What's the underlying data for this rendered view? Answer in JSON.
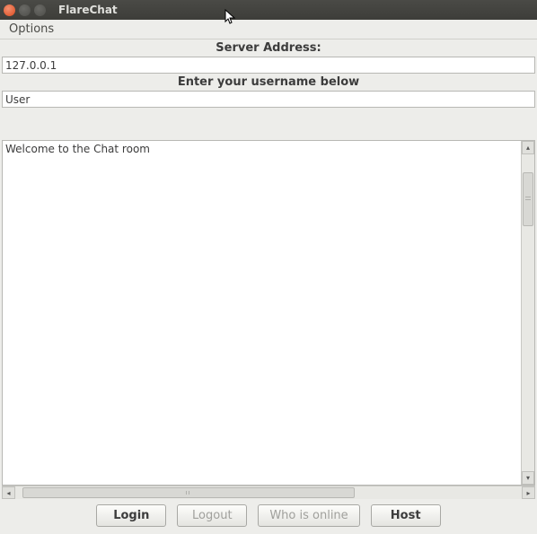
{
  "window": {
    "title": "FlareChat"
  },
  "menu": {
    "options": "Options"
  },
  "labels": {
    "server_address": "Server Address:",
    "username_prompt": "Enter your username below"
  },
  "inputs": {
    "server": "127.0.0.1",
    "username": "User"
  },
  "chat": {
    "welcome": "Welcome to the Chat room"
  },
  "buttons": {
    "login": "Login",
    "logout": "Logout",
    "who_online": "Who is online",
    "host": "Host"
  }
}
